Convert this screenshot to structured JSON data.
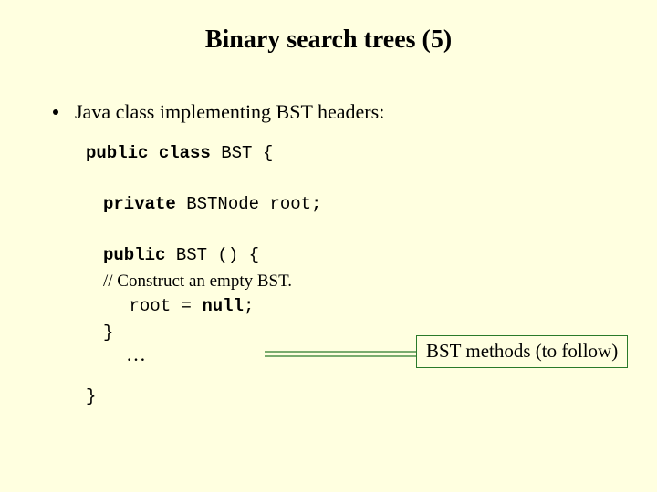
{
  "title": "Binary search trees (5)",
  "bullet": "Java class implementing BST headers:",
  "code": {
    "l1_kw": "public class",
    "l1_rest": " BST {",
    "l2_kw": "private",
    "l2_rest": " BSTNode root;",
    "l3_kw": "public",
    "l3_rest": " BST () {",
    "l4_comment": "// Construct an empty BST.",
    "l5_a": "root = ",
    "l5_kw": "null",
    "l5_b": ";",
    "l6": "}",
    "close": "}"
  },
  "ellipsis": "…",
  "callout": "BST methods (to follow)"
}
